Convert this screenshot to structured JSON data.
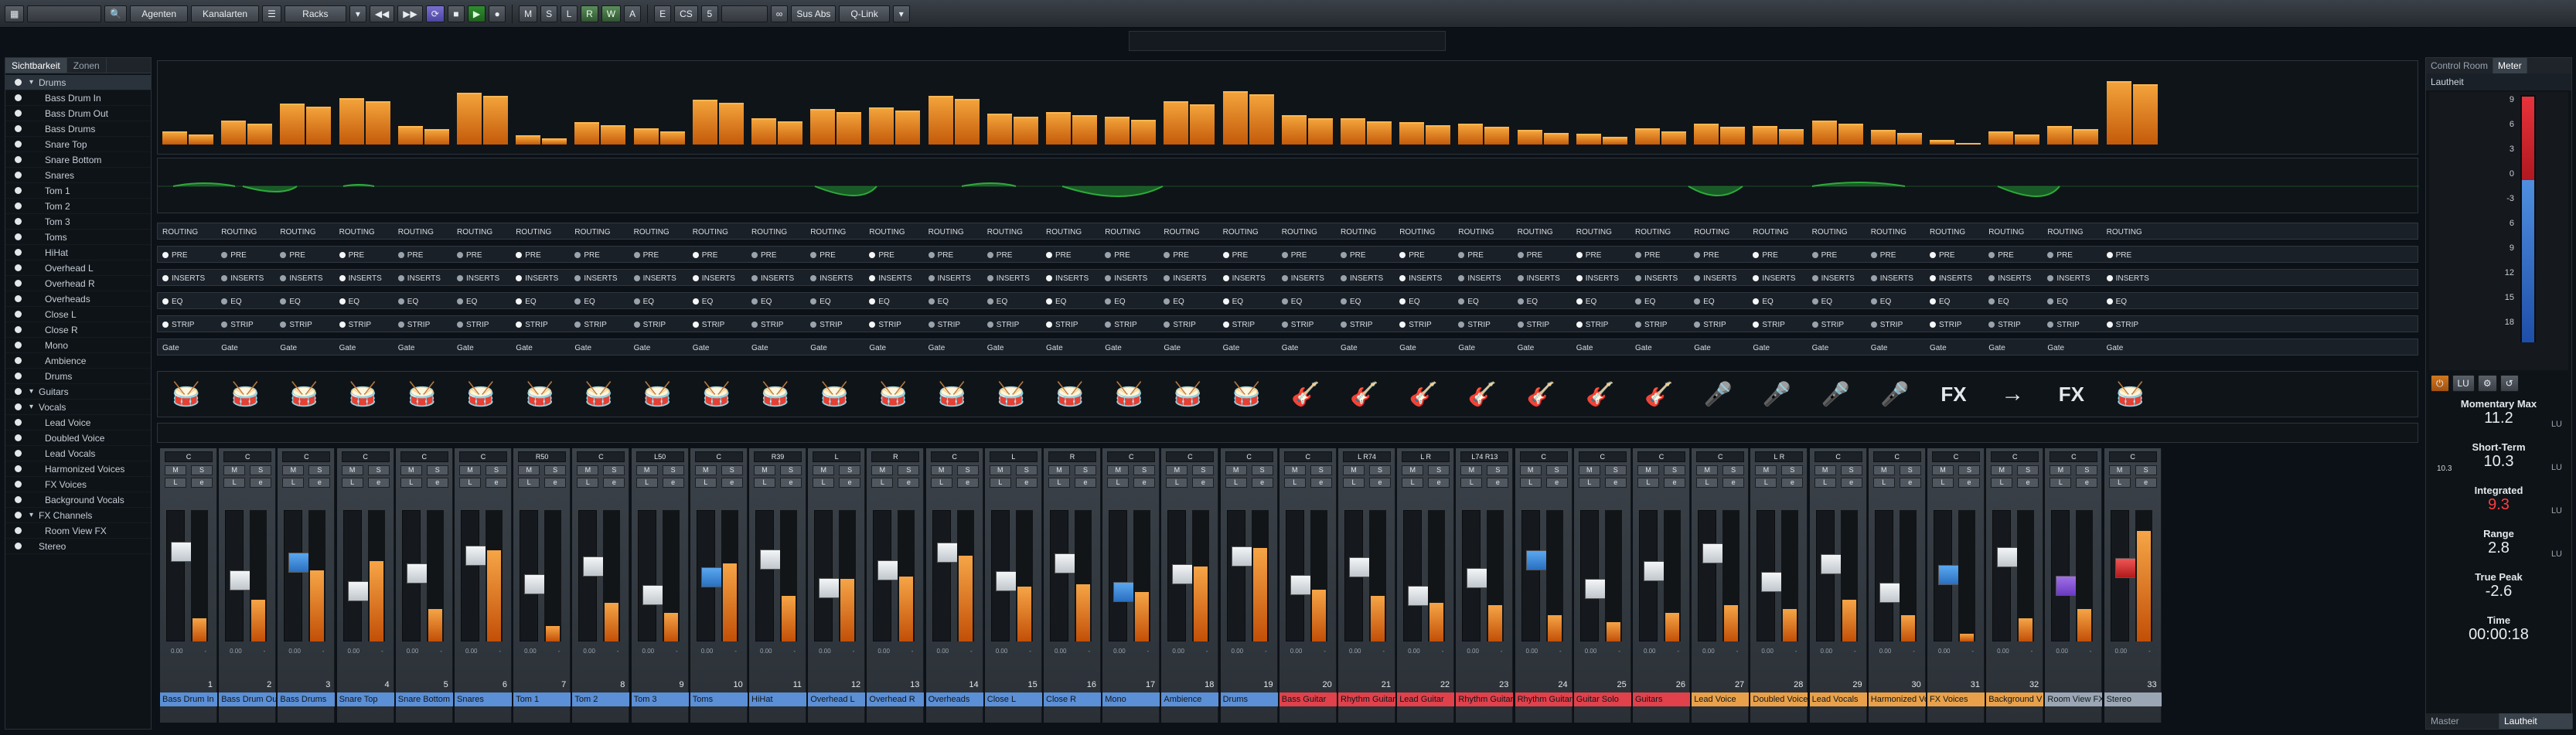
{
  "toolbar": {
    "items": [
      "Agenten",
      "Kanalarten",
      "Racks",
      "M",
      "S",
      "L",
      "R",
      "W",
      "A",
      "E",
      "CS",
      "5",
      "Sus Abs",
      "Q-Link"
    ],
    "colors": {
      "play": "#2f8e2f",
      "cycle": "#7a6fd0"
    }
  },
  "left": {
    "tab_visibility": "Sichtbarkeit",
    "tab_zones": "Zonen",
    "tree": [
      {
        "label": "Drums",
        "level": 0,
        "caret": true
      },
      {
        "label": "Bass Drum In",
        "level": 1
      },
      {
        "label": "Bass Drum Out",
        "level": 1
      },
      {
        "label": "Bass Drums",
        "level": 1
      },
      {
        "label": "Snare Top",
        "level": 1
      },
      {
        "label": "Snare Bottom",
        "level": 1
      },
      {
        "label": "Snares",
        "level": 1
      },
      {
        "label": "Tom 1",
        "level": 1
      },
      {
        "label": "Tom 2",
        "level": 1
      },
      {
        "label": "Tom 3",
        "level": 1
      },
      {
        "label": "Toms",
        "level": 1
      },
      {
        "label": "HiHat",
        "level": 1
      },
      {
        "label": "Overhead L",
        "level": 1
      },
      {
        "label": "Overhead R",
        "level": 1
      },
      {
        "label": "Overheads",
        "level": 1
      },
      {
        "label": "Close L",
        "level": 1
      },
      {
        "label": "Close R",
        "level": 1
      },
      {
        "label": "Mono",
        "level": 1
      },
      {
        "label": "Ambience",
        "level": 1
      },
      {
        "label": "Drums",
        "level": 1
      },
      {
        "label": "Guitars",
        "level": 0,
        "caret": true
      },
      {
        "label": "Vocals",
        "level": 0,
        "caret": true
      },
      {
        "label": "Lead Voice",
        "level": 1
      },
      {
        "label": "Doubled Voice",
        "level": 1
      },
      {
        "label": "Lead Vocals",
        "level": 1
      },
      {
        "label": "Harmonized Voices",
        "level": 1
      },
      {
        "label": "FX Voices",
        "level": 1
      },
      {
        "label": "Background Vocals",
        "level": 1
      },
      {
        "label": "FX Channels",
        "level": 0,
        "caret": true
      },
      {
        "label": "Room View FX",
        "level": 1
      },
      {
        "label": "Stereo",
        "level": 0
      }
    ]
  },
  "rack_rows": {
    "routing": "ROUTING",
    "pre": "PRE",
    "inserts": "INSERTS",
    "eq": "EQ",
    "strip": "STRIP",
    "gate": "Gate"
  },
  "channels": [
    {
      "num": "1",
      "name": "Bass Drum In",
      "pan": "C",
      "color": "#5b8fd6",
      "level": 0.18
    },
    {
      "num": "2",
      "name": "Bass Drum Out",
      "pan": "C",
      "color": "#5b8fd6",
      "level": 0.32
    },
    {
      "num": "3",
      "name": "Bass Drums",
      "pan": "C",
      "color": "#5b8fd6",
      "level": 0.55
    },
    {
      "num": "4",
      "name": "Snare Top",
      "pan": "C",
      "color": "#5b8fd6",
      "level": 0.62
    },
    {
      "num": "5",
      "name": "Snare Bottom",
      "pan": "C",
      "color": "#5b8fd6",
      "level": 0.25
    },
    {
      "num": "6",
      "name": "Snares",
      "pan": "C",
      "color": "#5b8fd6",
      "level": 0.7
    },
    {
      "num": "7",
      "name": "Tom 1",
      "pan": "R50",
      "color": "#5b8fd6",
      "level": 0.12
    },
    {
      "num": "8",
      "name": "Tom 2",
      "pan": "C",
      "color": "#5b8fd6",
      "level": 0.3
    },
    {
      "num": "9",
      "name": "Tom 3",
      "pan": "L50",
      "color": "#5b8fd6",
      "level": 0.22
    },
    {
      "num": "10",
      "name": "Toms",
      "pan": "C",
      "color": "#5b8fd6",
      "level": 0.6
    },
    {
      "num": "11",
      "name": "HiHat",
      "pan": "R39",
      "color": "#5b8fd6",
      "level": 0.35
    },
    {
      "num": "12",
      "name": "Overhead L",
      "pan": "L",
      "color": "#5b8fd6",
      "level": 0.48
    },
    {
      "num": "13",
      "name": "Overhead R",
      "pan": "R",
      "color": "#5b8fd6",
      "level": 0.5
    },
    {
      "num": "14",
      "name": "Overheads",
      "pan": "C",
      "color": "#5b8fd6",
      "level": 0.66
    },
    {
      "num": "15",
      "name": "Close L",
      "pan": "L",
      "color": "#5b8fd6",
      "level": 0.42
    },
    {
      "num": "16",
      "name": "Close R",
      "pan": "R",
      "color": "#5b8fd6",
      "level": 0.44
    },
    {
      "num": "17",
      "name": "Mono",
      "pan": "C",
      "color": "#5b8fd6",
      "level": 0.38
    },
    {
      "num": "18",
      "name": "Ambience",
      "pan": "C",
      "color": "#5b8fd6",
      "level": 0.58
    },
    {
      "num": "19",
      "name": "Drums",
      "pan": "C",
      "color": "#5b8fd6",
      "level": 0.72
    },
    {
      "num": "20",
      "name": "Bass Guitar",
      "pan": "C",
      "color": "#e0414b",
      "level": 0.4
    },
    {
      "num": "21",
      "name": "Rhythm Guitar",
      "pan": "L R74",
      "color": "#e0414b",
      "level": 0.35
    },
    {
      "num": "22",
      "name": "Lead Guitar",
      "pan": "L R",
      "color": "#e0414b",
      "level": 0.3
    },
    {
      "num": "23",
      "name": "Rhythm Guitar",
      "pan": "L74 R13",
      "color": "#e0414b",
      "level": 0.28
    },
    {
      "num": "24",
      "name": "Rhythm Guitar",
      "pan": "C",
      "color": "#e0414b",
      "level": 0.2
    },
    {
      "num": "25",
      "name": "Guitar Solo",
      "pan": "C",
      "color": "#e0414b",
      "level": 0.15
    },
    {
      "num": "26",
      "name": "Guitars",
      "pan": "C",
      "color": "#e0414b",
      "level": 0.22
    },
    {
      "num": "27",
      "name": "Lead Voice",
      "pan": "C",
      "color": "#e8a14a",
      "level": 0.28
    },
    {
      "num": "28",
      "name": "Doubled Voice",
      "pan": "L R",
      "color": "#e8a14a",
      "level": 0.25
    },
    {
      "num": "29",
      "name": "Lead Vocals",
      "pan": "C",
      "color": "#e8a14a",
      "level": 0.32
    },
    {
      "num": "30",
      "name": "Harmonized Vo",
      "pan": "C",
      "color": "#e8a14a",
      "level": 0.2
    },
    {
      "num": "31",
      "name": "FX Voices",
      "pan": "C",
      "color": "#e8a14a",
      "level": 0.06
    },
    {
      "num": "32",
      "name": "Background V",
      "pan": "C",
      "color": "#e8a14a",
      "level": 0.18
    },
    {
      "num": "",
      "name": "Room View FX",
      "pan": "C",
      "color": "#9aa6b4",
      "level": 0.25
    },
    {
      "num": "33",
      "name": "Stereo",
      "pan": "C",
      "color": "#9aa6b4",
      "level": 0.85
    }
  ],
  "right": {
    "tab_control_room": "Control Room",
    "tab_meter": "Meter",
    "section_label": "Lautheit",
    "scale": [
      "9",
      "6",
      "3",
      "0",
      "-3",
      "6",
      "9",
      "12",
      "15",
      "18"
    ],
    "lu_label": "LU",
    "momentary_label": "Momentary Max",
    "momentary_value": "11.2",
    "short_term_label": "Short-Term",
    "short_term_value": "10.3",
    "short_term_min": "10.3",
    "integrated_label": "Integrated",
    "integrated_value": "9.3",
    "range_label": "Range",
    "range_value": "2.8",
    "true_peak_label": "True Peak",
    "true_peak_value": "-2.6",
    "time_label": "Time",
    "time_value": "00:00:18",
    "unit": "LU",
    "bottom_master": "Master",
    "bottom_lautheit": "Lautheit"
  }
}
